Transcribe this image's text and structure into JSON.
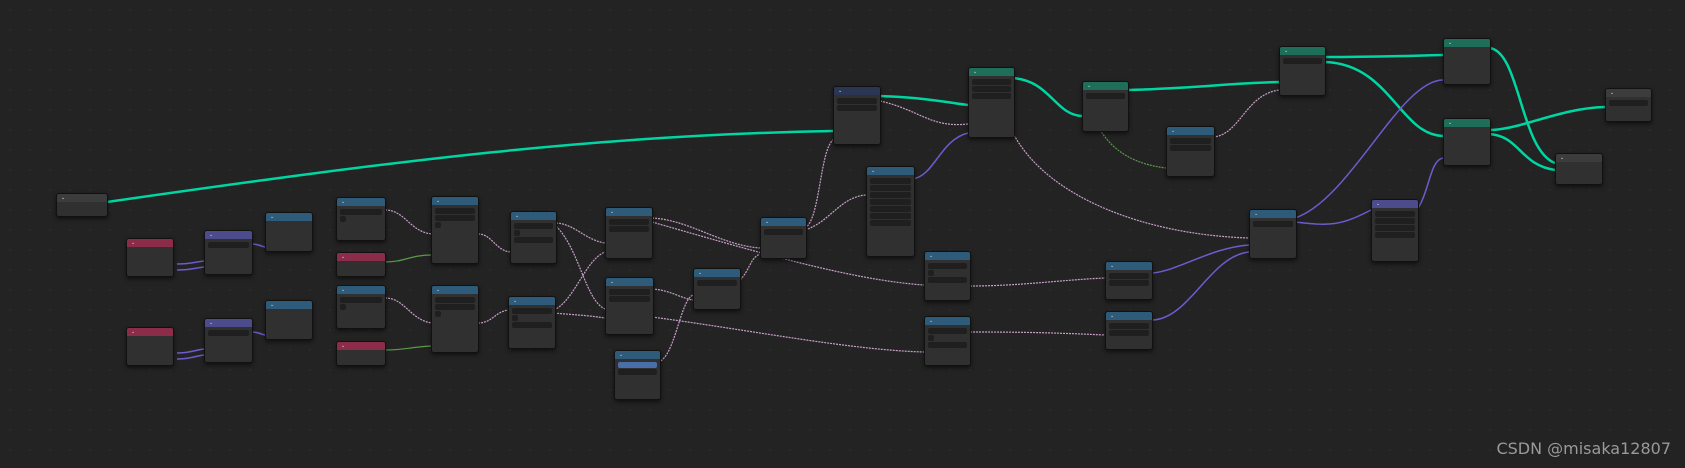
{
  "watermark": "CSDN @misaka12807",
  "colors": {
    "background": "#232323",
    "wire_geometry": "#00d6a3",
    "wire_vector": "#6c5ccf",
    "wire_float": "#c8a0c8",
    "wire_green": "#5a9a4a"
  }
}
